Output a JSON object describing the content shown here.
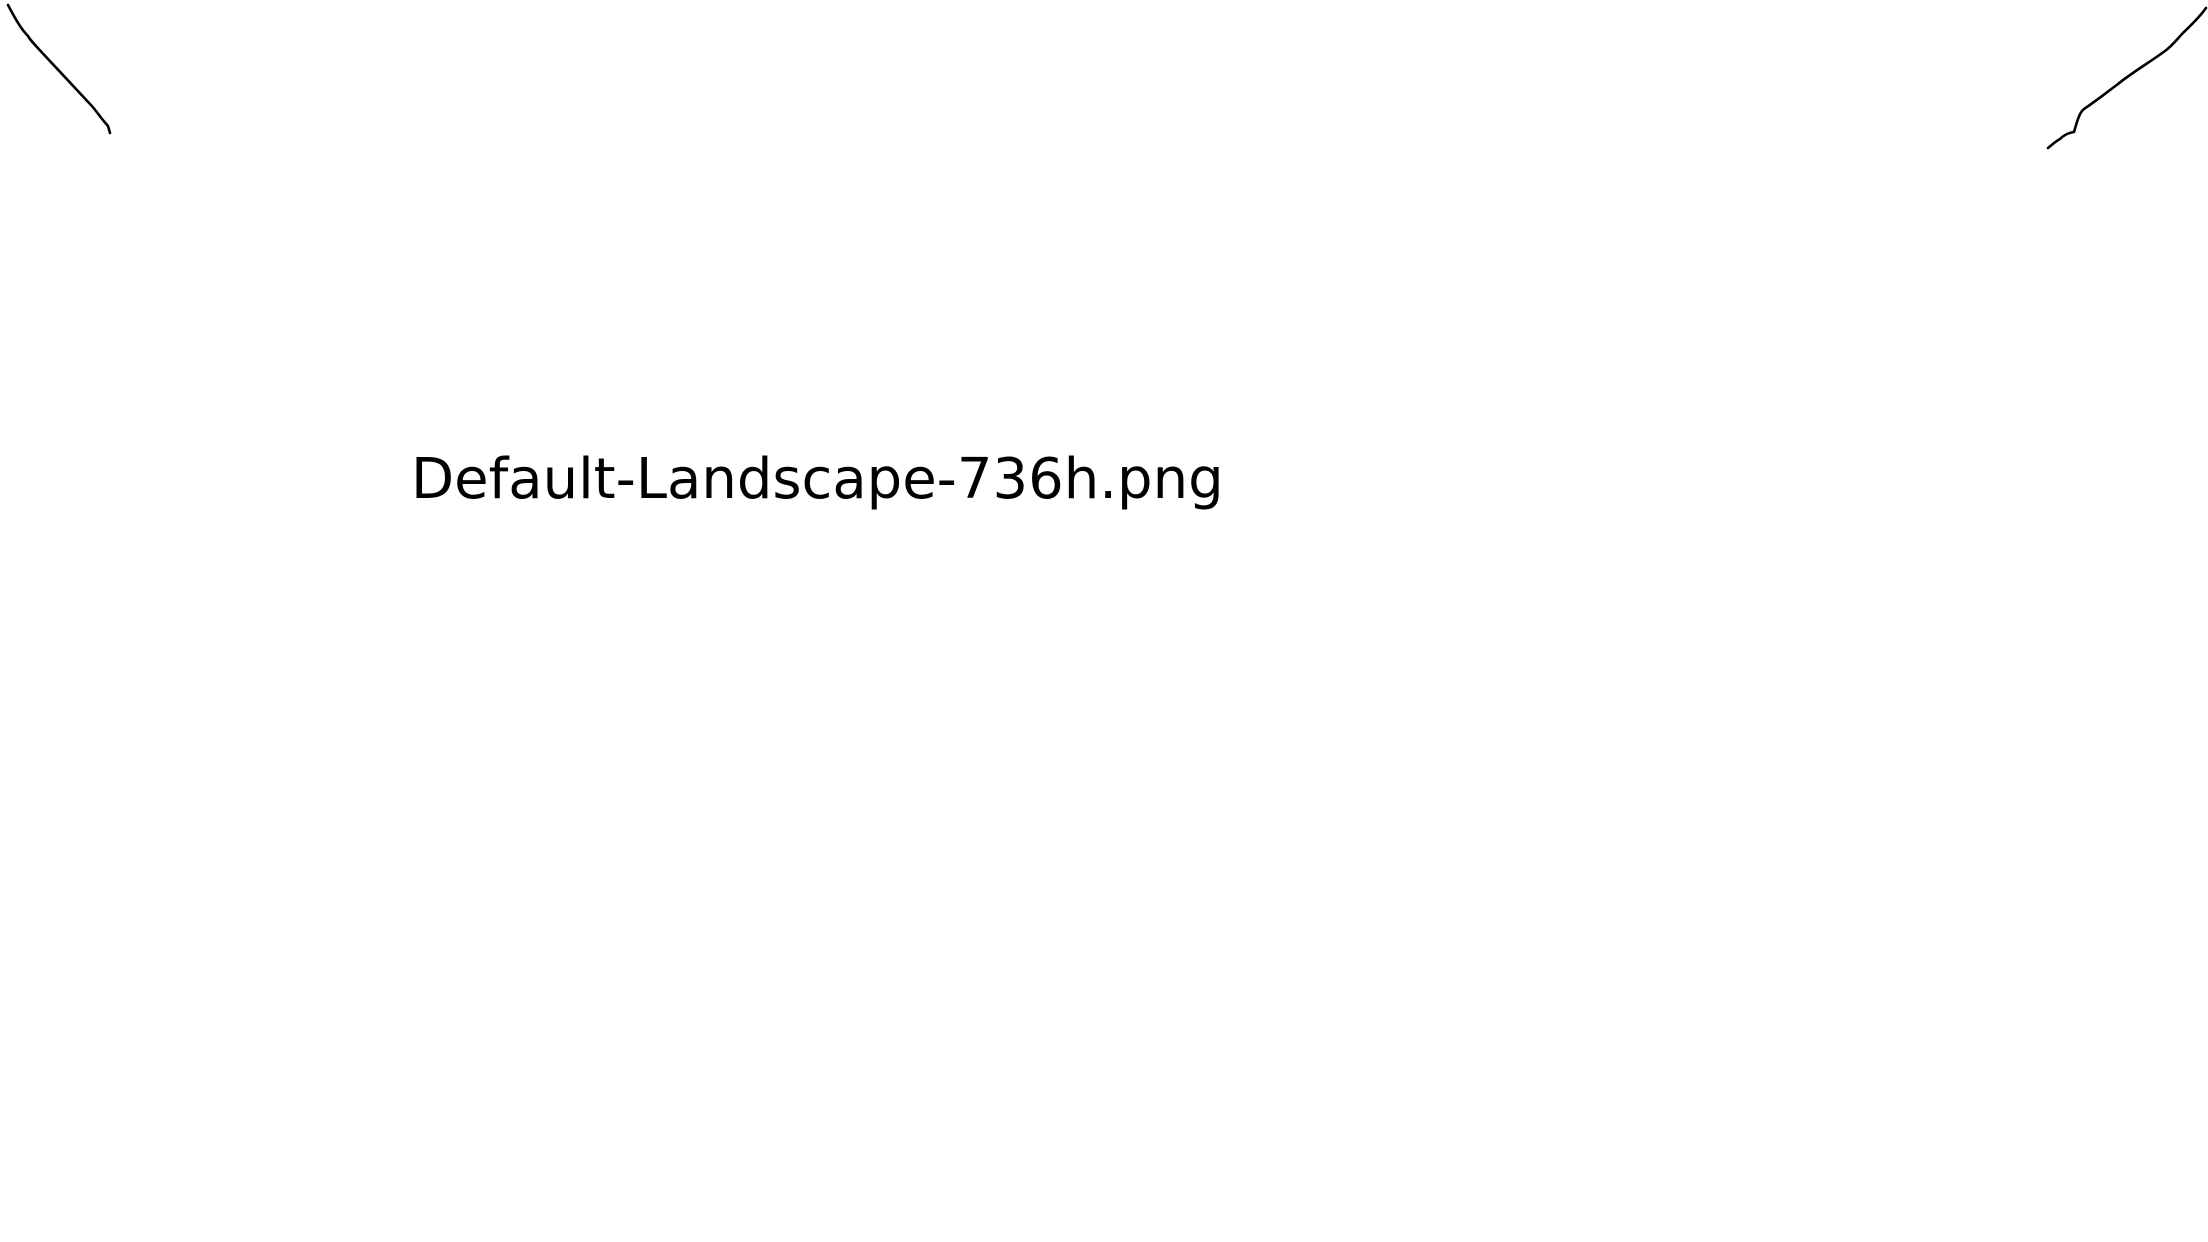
{
  "label": {
    "text": "Default-Landscape-736h.png"
  },
  "colors": {
    "background": "#ffffff",
    "ink": "#000000"
  },
  "marks": {
    "left": "hand-drawn-stroke",
    "right": "hand-drawn-stroke"
  }
}
